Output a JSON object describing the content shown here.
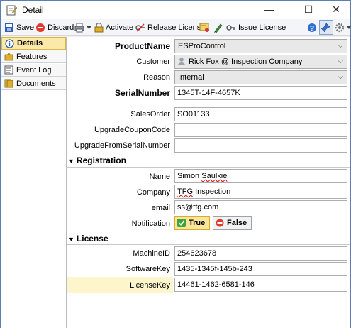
{
  "window": {
    "title": "Detail",
    "minimize_glyph": "—",
    "maximize_glyph": "☐",
    "close_glyph": "✕"
  },
  "toolbar": {
    "save_label": "Save",
    "discard_label": "Discard",
    "activate_label": "Activate",
    "release_license_label": "Release License",
    "issue_license_label": "Issue License"
  },
  "sidebar": {
    "items": [
      {
        "label": "Details",
        "icon": "info-icon",
        "active": true
      },
      {
        "label": "Features",
        "icon": "puzzle-icon",
        "active": false
      },
      {
        "label": "Event Log",
        "icon": "log-icon",
        "active": false
      },
      {
        "label": "Documents",
        "icon": "documents-icon",
        "active": false
      }
    ]
  },
  "form": {
    "product_name_label": "ProductName",
    "product_name_value": "ESProControl",
    "customer_label": "Customer",
    "customer_value": "Rick Fox @ Inspection Company",
    "reason_label": "Reason",
    "reason_value": "Internal",
    "serial_number_label": "SerialNumber",
    "serial_number_value": "1345T-14F-4657K",
    "sales_order_label": "SalesOrder",
    "sales_order_value": "SO01133",
    "upgrade_coupon_label": "UpgradeCouponCode",
    "upgrade_coupon_value": "",
    "upgrade_serial_label": "UpgradeFromSerialNumber",
    "upgrade_serial_value": ""
  },
  "registration": {
    "section_title": "Registration",
    "name_label": "Name",
    "name_first": "Simon",
    "name_last": "Saulkie",
    "company_label": "Company",
    "company_first": "TFG",
    "company_rest": "Inspection",
    "email_label": "email",
    "email_value": "ss@tfg.com",
    "notification_label": "Notification",
    "true_label": "True",
    "false_label": "False",
    "notification_value": true
  },
  "license": {
    "section_title": "License",
    "machine_id_label": "MachineID",
    "machine_id_value": "254623678",
    "software_key_label": "SoftwareKey",
    "software_key_value": "1435-1345f-145b-243",
    "license_key_label": "LicenseKey",
    "license_key_value": "14461-1462-6581-146"
  },
  "colors": {
    "active_nav": "#fbe9a8",
    "highlight_row": "#fdf6cc",
    "window_border": "#5a7fb0"
  }
}
